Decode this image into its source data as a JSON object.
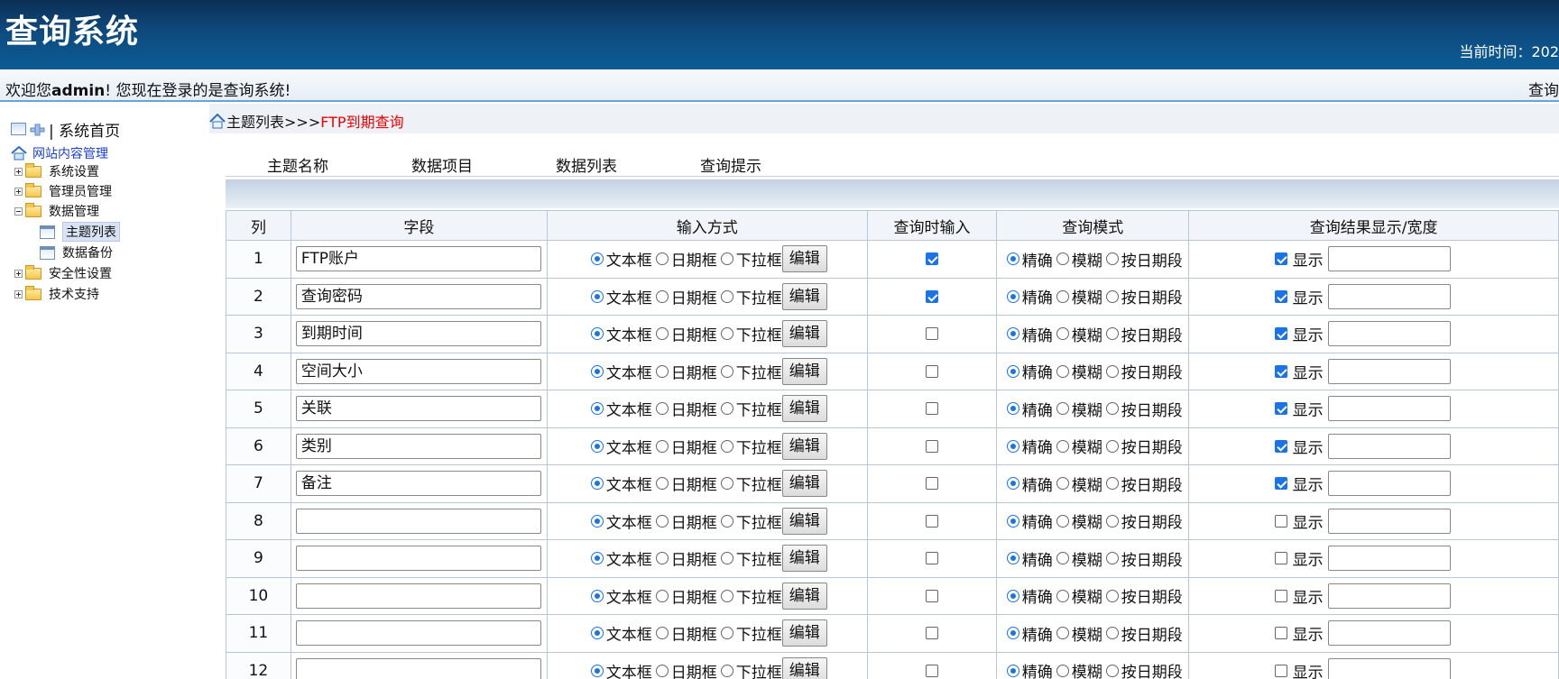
{
  "header": {
    "title": "查询系统",
    "time_label": "当前时间：202"
  },
  "welcome": {
    "prefix": "欢迎您",
    "user": "admin",
    "suffix": "! 您现在登录的是查询系统!",
    "right": "查询"
  },
  "sidebar": {
    "home": "| 系统首页",
    "site_manage": "网站内容管理",
    "items": [
      {
        "label": "系统设置",
        "expanded": false
      },
      {
        "label": "管理员管理",
        "expanded": false
      },
      {
        "label": "数据管理",
        "expanded": true
      },
      {
        "label": "主题列表",
        "child": true,
        "selected": true
      },
      {
        "label": "数据备份",
        "child": true
      },
      {
        "label": "安全性设置",
        "expanded": false
      },
      {
        "label": "技术支持",
        "expanded": false
      }
    ]
  },
  "breadcrumb": {
    "base": "主题列表>>>",
    "current": "FTP到期查询"
  },
  "tabs": [
    "主题名称",
    "数据项目",
    "数据列表",
    "查询提示"
  ],
  "table": {
    "headers": [
      "列",
      "字段",
      "输入方式",
      "查询时输入",
      "查询模式",
      "查询结果显示/宽度"
    ],
    "input_options": [
      "文本框",
      "日期框",
      "下拉框"
    ],
    "edit_label": "编辑",
    "mode_options": [
      "精确",
      "模糊",
      "按日期段"
    ],
    "show_label": "显示",
    "rows": [
      {
        "n": "1",
        "field": "FTP账户",
        "query_input": true,
        "show": true
      },
      {
        "n": "2",
        "field": "查询密码",
        "query_input": true,
        "show": true
      },
      {
        "n": "3",
        "field": "到期时间",
        "query_input": false,
        "show": true
      },
      {
        "n": "4",
        "field": "空间大小",
        "query_input": false,
        "show": true
      },
      {
        "n": "5",
        "field": "关联",
        "query_input": false,
        "show": true
      },
      {
        "n": "6",
        "field": "类别",
        "query_input": false,
        "show": true
      },
      {
        "n": "7",
        "field": "备注",
        "query_input": false,
        "show": true
      },
      {
        "n": "8",
        "field": "",
        "query_input": false,
        "show": false
      },
      {
        "n": "9",
        "field": "",
        "query_input": false,
        "show": false
      },
      {
        "n": "10",
        "field": "",
        "query_input": false,
        "show": false
      },
      {
        "n": "11",
        "field": "",
        "query_input": false,
        "show": false
      },
      {
        "n": "12",
        "field": "",
        "query_input": false,
        "show": false
      }
    ]
  },
  "colors": {
    "header_dark": "#0b2f55",
    "header_light": "#0b5c95",
    "link_blue": "#1a3fd1",
    "crumb_red": "#e00000",
    "accent": "#1a73e8"
  }
}
